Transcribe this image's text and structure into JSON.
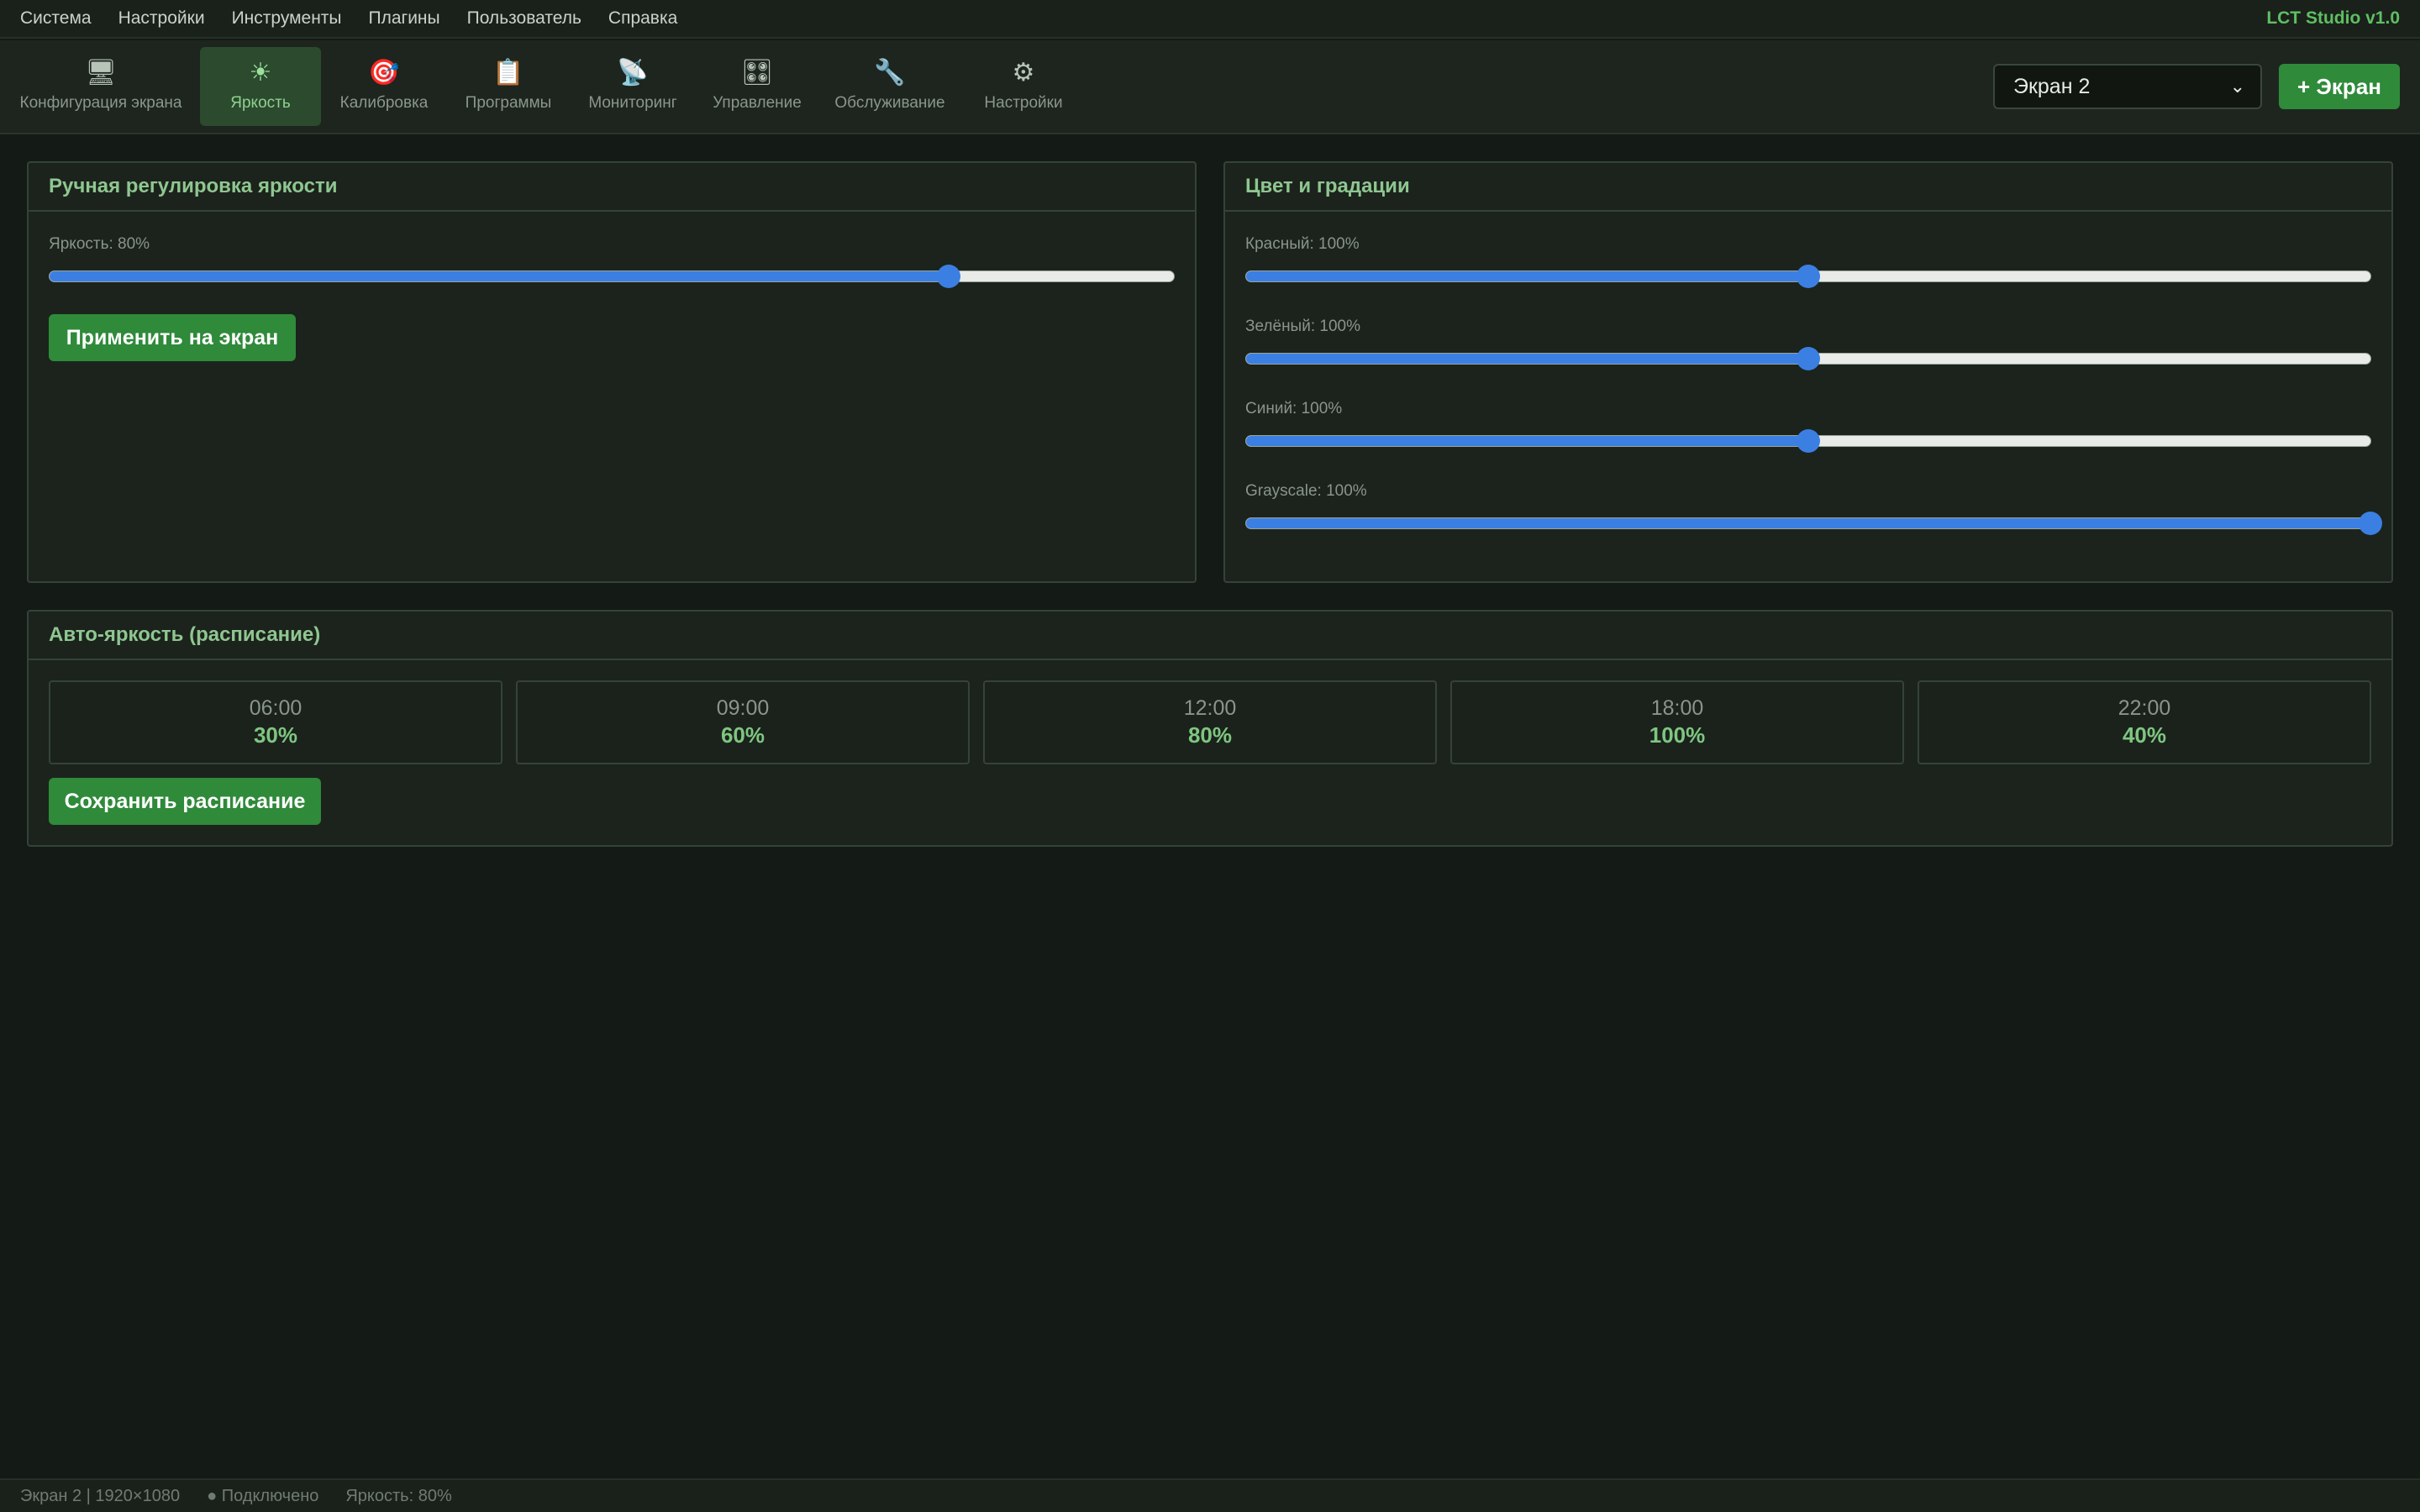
{
  "menu": {
    "items": [
      "Система",
      "Настройки",
      "Инструменты",
      "Плагины",
      "Пользователь",
      "Справка"
    ],
    "brand": "LCT Studio v1.0"
  },
  "toolbar": {
    "items": [
      {
        "label": "Конфигурация экрана",
        "icon": "monitor-icon",
        "glyph": "🖥"
      },
      {
        "label": "Яркость",
        "icon": "sun-icon",
        "glyph": "☀",
        "active": true
      },
      {
        "label": "Калибровка",
        "icon": "target-icon",
        "glyph": "🎯"
      },
      {
        "label": "Программы",
        "icon": "clipboard-icon",
        "glyph": "📋"
      },
      {
        "label": "Мониторинг",
        "icon": "satellite-icon",
        "glyph": "📡"
      },
      {
        "label": "Управление",
        "icon": "control-knobs-icon",
        "glyph": "🎛"
      },
      {
        "label": "Обслуживание",
        "icon": "wrench-icon",
        "glyph": "🔧"
      },
      {
        "label": "Настройки",
        "icon": "gear-icon",
        "glyph": "⚙"
      }
    ],
    "screen_select": "Экран 2",
    "add_screen": "+ Экран"
  },
  "manual": {
    "title": "Ручная регулировка яркости",
    "brightness_label": "Яркость: 80%",
    "brightness_value": 80,
    "apply_button": "Применить на экран"
  },
  "color": {
    "title": "Цвет и градации",
    "sliders": [
      {
        "label": "Красный: 100%",
        "position": 0.5
      },
      {
        "label": "Зелёный: 100%",
        "position": 0.5
      },
      {
        "label": "Синий: 100%",
        "position": 0.5
      },
      {
        "label": "Grayscale: 100%",
        "position": 1.0
      }
    ]
  },
  "schedule": {
    "title": "Авто-яркость (расписание)",
    "entries": [
      {
        "time": "06:00",
        "percent": "30%"
      },
      {
        "time": "09:00",
        "percent": "60%"
      },
      {
        "time": "12:00",
        "percent": "80%"
      },
      {
        "time": "18:00",
        "percent": "100%"
      },
      {
        "time": "22:00",
        "percent": "40%"
      }
    ],
    "save_button": "Сохранить расписание"
  },
  "status": {
    "screen": "Экран 2 | 1920×1080",
    "connection": "● Подключено",
    "brightness": "Яркость: 80%"
  },
  "colors": {
    "accent_green": "#2f8a3a",
    "slider_blue": "#3b7fe3",
    "background": "#141a15"
  }
}
